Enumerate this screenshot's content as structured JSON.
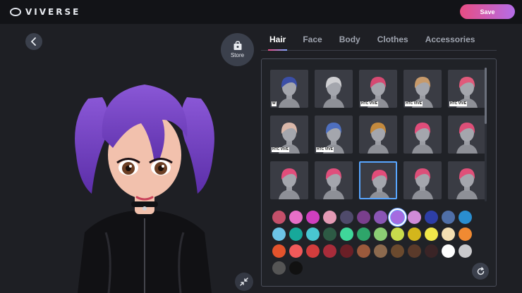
{
  "app": {
    "brand": "VIVERSE"
  },
  "toolbar": {
    "save_label": "Save"
  },
  "store": {
    "label": "Store"
  },
  "tabs": [
    {
      "label": "Hair",
      "active": true
    },
    {
      "label": "Face",
      "active": false
    },
    {
      "label": "Body",
      "active": false
    },
    {
      "label": "Clothes",
      "active": false
    },
    {
      "label": "Accessories",
      "active": false
    }
  ],
  "hair_items": [
    {
      "name": "blue-bun",
      "hair": "#3b4fa8",
      "badge": "W",
      "selected": false
    },
    {
      "name": "white-cap",
      "hair": "#cfcfd2",
      "badge": "",
      "selected": false
    },
    {
      "name": "pink-beanie",
      "hair": "#d64a72",
      "badge": "HTC VIVE",
      "selected": false
    },
    {
      "name": "beret",
      "hair": "#c79a6b",
      "badge": "HTC VIVE",
      "selected": false
    },
    {
      "name": "pink-cap",
      "hair": "#e05a7b",
      "badge": "HTC VIVE",
      "selected": false
    },
    {
      "name": "white-headband",
      "hair": "#d9b7a9",
      "badge": "HTC VIVE",
      "selected": false
    },
    {
      "name": "blue-beret",
      "hair": "#4e6fbf",
      "badge": "HTC VIVE",
      "selected": false
    },
    {
      "name": "goggles-hat",
      "hair": "#c48a3e",
      "badge": "",
      "selected": false
    },
    {
      "name": "pink-short",
      "hair": "#e04d7a",
      "badge": "",
      "selected": false
    },
    {
      "name": "pink-spiky",
      "hair": "#dd4f78",
      "badge": "",
      "selected": false
    },
    {
      "name": "pink-twin-1",
      "hair": "#e24d7b",
      "badge": "",
      "selected": false
    },
    {
      "name": "pink-bob",
      "hair": "#df4f7c",
      "badge": "",
      "selected": false
    },
    {
      "name": "pink-twintails",
      "hair": "#e14c79",
      "badge": "",
      "selected": true
    },
    {
      "name": "pink-bangs",
      "hair": "#dc4f79",
      "badge": "",
      "selected": false
    },
    {
      "name": "pink-messy",
      "hair": "#e05079",
      "badge": "",
      "selected": false
    }
  ],
  "swatches": [
    {
      "color": "#c4506a",
      "selected": false
    },
    {
      "color": "#e66fc7",
      "selected": false
    },
    {
      "color": "#cf3fbf",
      "selected": false
    },
    {
      "color": "#e49ab5",
      "selected": false
    },
    {
      "color": "#4f4a6b",
      "selected": false
    },
    {
      "color": "#7a3f8d",
      "selected": false
    },
    {
      "color": "#8a55b5",
      "selected": false
    },
    {
      "color": "#a56be0",
      "selected": true
    },
    {
      "color": "#d08bd8",
      "selected": false
    },
    {
      "color": "#2d3ea6",
      "selected": false
    },
    {
      "color": "#4f6fa8",
      "selected": false
    },
    {
      "color": "#2a8ed0",
      "selected": false
    },
    {
      "color": "#6cc3e6",
      "selected": false
    },
    {
      "color": "#17a89a",
      "selected": false
    },
    {
      "color": "#49c6d0",
      "selected": false
    },
    {
      "color": "#2d5a44",
      "selected": false
    },
    {
      "color": "#3fd79a",
      "selected": false
    },
    {
      "color": "#2ea56a",
      "selected": false
    },
    {
      "color": "#8ccd74",
      "selected": false
    },
    {
      "color": "#c8dc4c",
      "selected": false
    },
    {
      "color": "#d3b61c",
      "selected": false
    },
    {
      "color": "#f1e84a",
      "selected": false
    },
    {
      "color": "#f3dfb2",
      "selected": false
    },
    {
      "color": "#f08a32",
      "selected": false
    },
    {
      "color": "#e3532c",
      "selected": false
    },
    {
      "color": "#f15a5a",
      "selected": false
    },
    {
      "color": "#d23d3d",
      "selected": false
    },
    {
      "color": "#a82c3a",
      "selected": false
    },
    {
      "color": "#6a1f26",
      "selected": false
    },
    {
      "color": "#9b5a3c",
      "selected": false
    },
    {
      "color": "#8c6a4e",
      "selected": false
    },
    {
      "color": "#6b4a2e",
      "selected": false
    },
    {
      "color": "#5a3a2a",
      "selected": false
    },
    {
      "color": "#3a2426",
      "selected": false
    },
    {
      "color": "#ffffff",
      "selected": false
    },
    {
      "color": "#c9c9cc",
      "selected": false
    },
    {
      "color": "#555555",
      "selected": false
    },
    {
      "color": "#111111",
      "selected": false
    }
  ],
  "avatar": {
    "hair_color": "#8a57d6",
    "hair_tip_color": "#5b2ea8",
    "skin_color": "#f2c1ad",
    "outfit_color": "#111114"
  },
  "icons": {
    "back": "chevron-left-icon",
    "store": "shopping-bag-icon",
    "collapse": "collapse-arrows-icon",
    "reset": "refresh-icon"
  }
}
